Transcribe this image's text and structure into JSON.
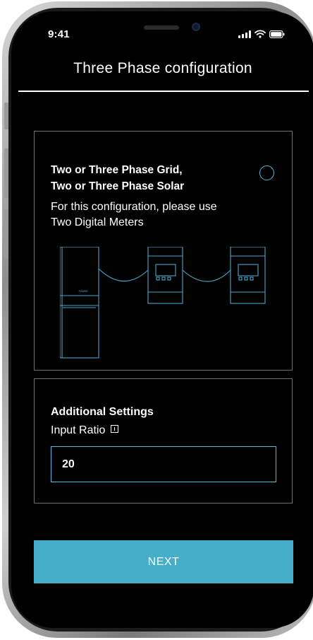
{
  "status_bar": {
    "time": "9:41"
  },
  "header": {
    "title": "Three Phase configuration"
  },
  "config_option": {
    "heading_line1": "Two or Three Phase Grid,",
    "heading_line2": "Two or Three Phase Solar",
    "description_line1": "For this configuration, please use",
    "description_line2": "Two Digital Meters",
    "selected": false,
    "device_brand_mark": "Aiswei"
  },
  "settings": {
    "heading": "Additional Settings",
    "input_ratio_label": "Input Ratio",
    "input_ratio_value": "20"
  },
  "footer": {
    "next_label": "NEXT"
  },
  "colors": {
    "accent": "#47aec9",
    "outline": "#5fb7dc",
    "background": "#000000"
  }
}
